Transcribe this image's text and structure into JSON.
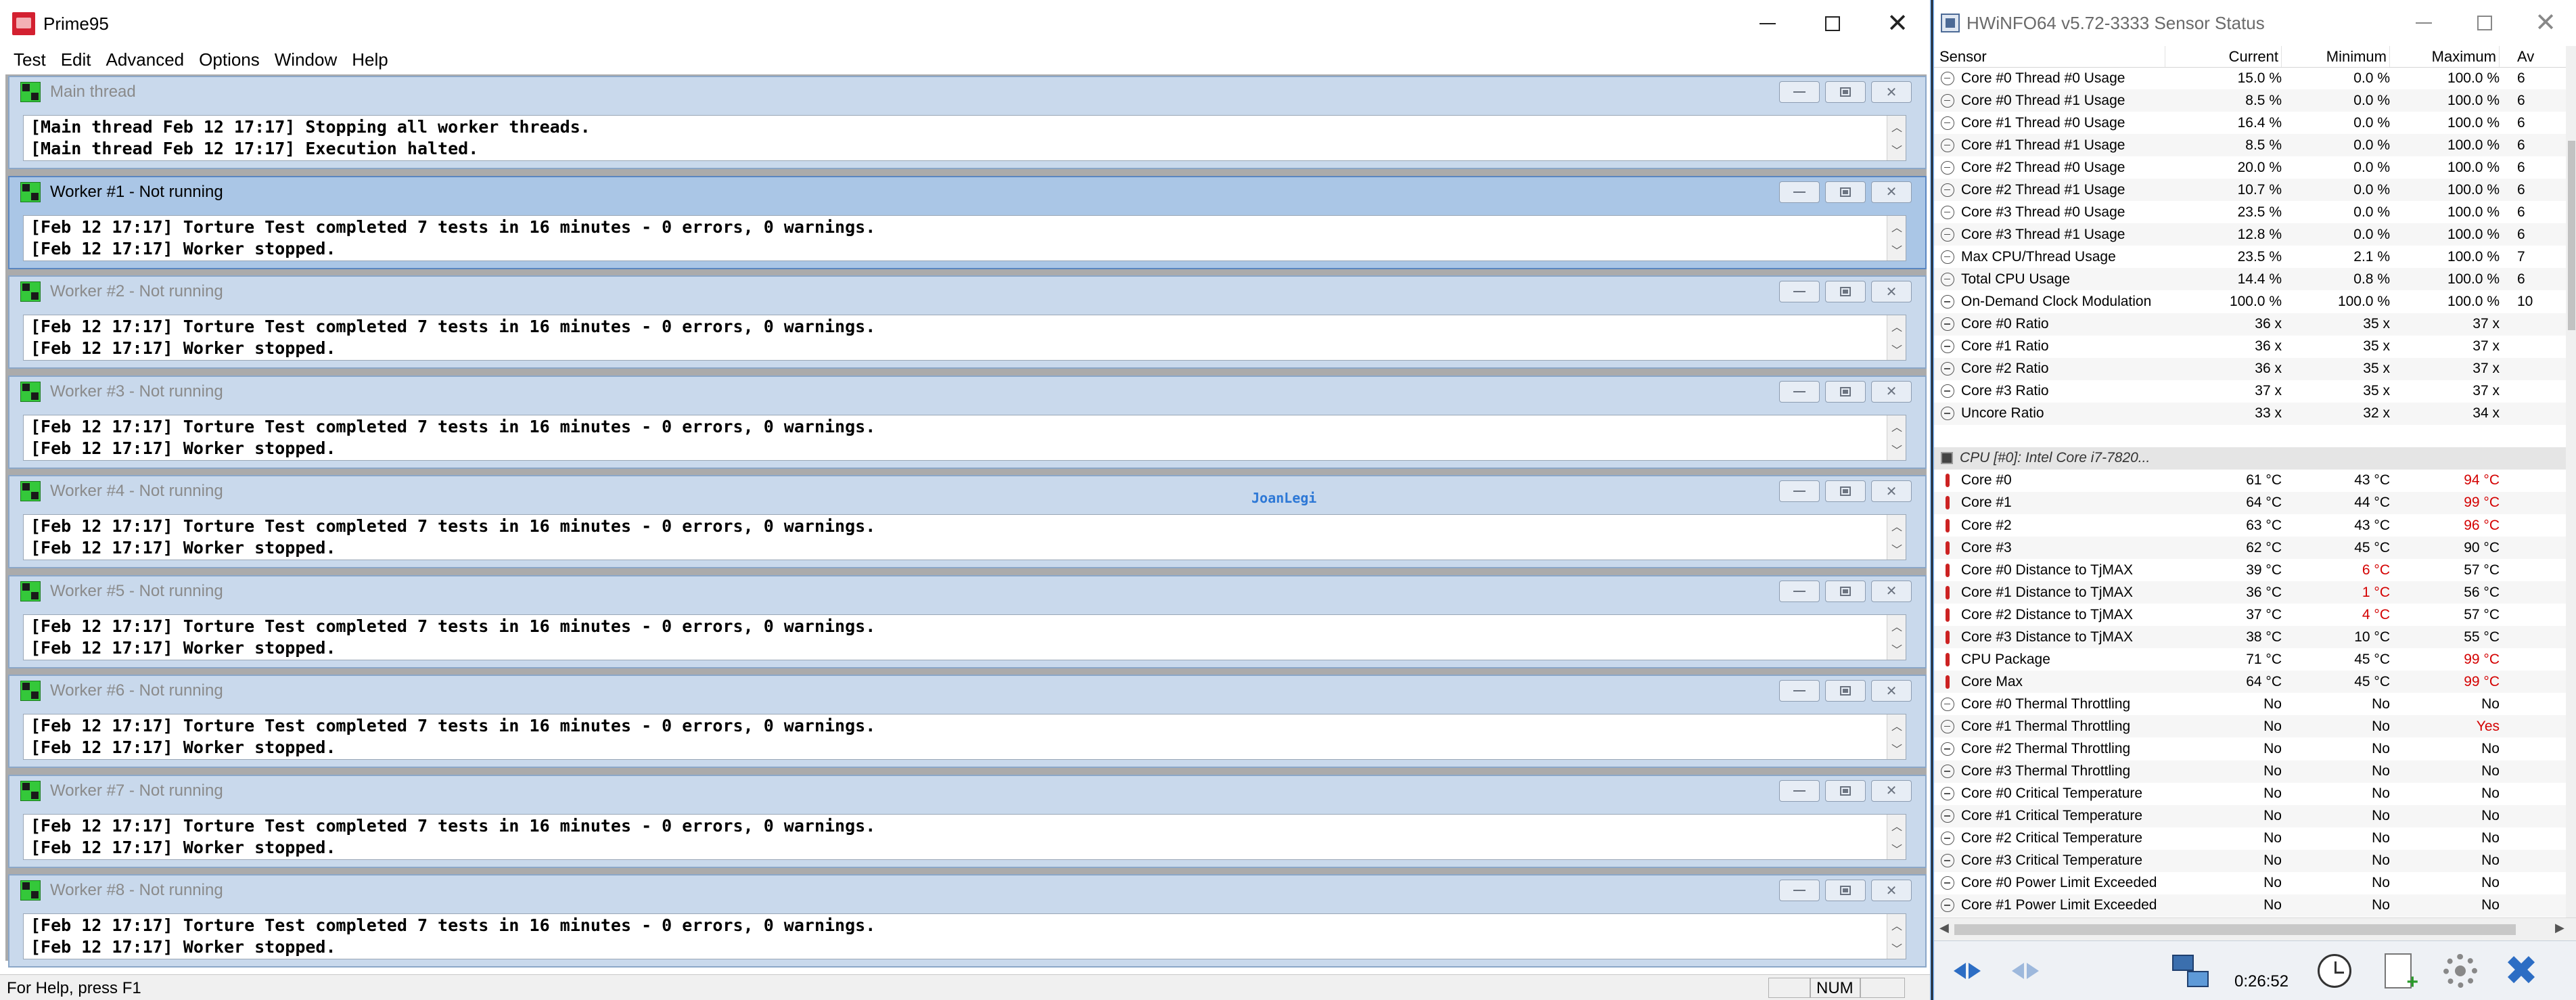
{
  "prime95": {
    "title": "Prime95",
    "menu": [
      "Test",
      "Edit",
      "Advanced",
      "Options",
      "Window",
      "Help"
    ],
    "workers": [
      {
        "name": "Main thread",
        "active": false,
        "lines": [
          "[Main thread Feb 12 17:17] Stopping all worker threads.",
          "[Main thread Feb 12 17:17] Execution halted."
        ]
      },
      {
        "name": "Worker #1 - Not running",
        "active": true,
        "lines": [
          "[Feb 12 17:17] Torture Test completed 7 tests in 16 minutes - 0 errors, 0 warnings.",
          "[Feb 12 17:17] Worker stopped."
        ]
      },
      {
        "name": "Worker #2 - Not running",
        "active": false,
        "lines": [
          "[Feb 12 17:17] Torture Test completed 7 tests in 16 minutes - 0 errors, 0 warnings.",
          "[Feb 12 17:17] Worker stopped."
        ]
      },
      {
        "name": "Worker #3 - Not running",
        "active": false,
        "lines": [
          "[Feb 12 17:17] Torture Test completed 7 tests in 16 minutes - 0 errors, 0 warnings.",
          "[Feb 12 17:17] Worker stopped."
        ]
      },
      {
        "name": "Worker #4 - Not running",
        "active": false,
        "lines": [
          "[Feb 12 17:17] Torture Test completed 7 tests in 16 minutes - 0 errors, 0 warnings.",
          "[Feb 12 17:17] Worker stopped."
        ]
      },
      {
        "name": "Worker #5 - Not running",
        "active": false,
        "lines": [
          "[Feb 12 17:17] Torture Test completed 7 tests in 16 minutes - 0 errors, 0 warnings.",
          "[Feb 12 17:17] Worker stopped."
        ]
      },
      {
        "name": "Worker #6 - Not running",
        "active": false,
        "lines": [
          "[Feb 12 17:17] Torture Test completed 7 tests in 16 minutes - 0 errors, 0 warnings.",
          "[Feb 12 17:17] Worker stopped."
        ]
      },
      {
        "name": "Worker #7 - Not running",
        "active": false,
        "lines": [
          "[Feb 12 17:17] Torture Test completed 7 tests in 16 minutes - 0 errors, 0 warnings.",
          "[Feb 12 17:17] Worker stopped."
        ]
      },
      {
        "name": "Worker #8 - Not running",
        "active": false,
        "lines": [
          "[Feb 12 17:17] Torture Test completed 7 tests in 16 minutes - 0 errors, 0 warnings.",
          "[Feb 12 17:17] Worker stopped."
        ]
      }
    ],
    "watermark": "JoanLegi",
    "status_text": "For Help, press F1",
    "status_num": "NUM"
  },
  "hwinfo": {
    "title": "HWiNFO64 v5.72-3333 Sensor Status",
    "columns": {
      "sensor": "Sensor",
      "current": "Current",
      "minimum": "Minimum",
      "maximum": "Maximum",
      "average": "Av"
    },
    "rows": [
      {
        "icon": "clock",
        "label": "Core #0 Thread #0 Usage",
        "cur": "15.0 %",
        "min": "0.0 %",
        "max": "100.0 %",
        "avg": "6"
      },
      {
        "icon": "clock",
        "label": "Core #0 Thread #1 Usage",
        "cur": "8.5 %",
        "min": "0.0 %",
        "max": "100.0 %",
        "avg": "6"
      },
      {
        "icon": "clock",
        "label": "Core #1 Thread #0 Usage",
        "cur": "16.4 %",
        "min": "0.0 %",
        "max": "100.0 %",
        "avg": "6"
      },
      {
        "icon": "clock",
        "label": "Core #1 Thread #1 Usage",
        "cur": "8.5 %",
        "min": "0.0 %",
        "max": "100.0 %",
        "avg": "6"
      },
      {
        "icon": "clock",
        "label": "Core #2 Thread #0 Usage",
        "cur": "20.0 %",
        "min": "0.0 %",
        "max": "100.0 %",
        "avg": "6"
      },
      {
        "icon": "clock",
        "label": "Core #2 Thread #1 Usage",
        "cur": "10.7 %",
        "min": "0.0 %",
        "max": "100.0 %",
        "avg": "6"
      },
      {
        "icon": "clock",
        "label": "Core #3 Thread #0 Usage",
        "cur": "23.5 %",
        "min": "0.0 %",
        "max": "100.0 %",
        "avg": "6"
      },
      {
        "icon": "clock",
        "label": "Core #3 Thread #1 Usage",
        "cur": "12.8 %",
        "min": "0.0 %",
        "max": "100.0 %",
        "avg": "6"
      },
      {
        "icon": "clock",
        "label": "Max CPU/Thread Usage",
        "cur": "23.5 %",
        "min": "2.1 %",
        "max": "100.0 %",
        "avg": "7"
      },
      {
        "icon": "clock",
        "label": "Total CPU Usage",
        "cur": "14.4 %",
        "min": "0.8 %",
        "max": "100.0 %",
        "avg": "6"
      },
      {
        "icon": "clock",
        "label": "On-Demand Clock Modulation",
        "cur": "100.0 %",
        "min": "100.0 %",
        "max": "100.0 %",
        "avg": "10"
      },
      {
        "icon": "clock",
        "label": "Core #0 Ratio",
        "cur": "36 x",
        "min": "35 x",
        "max": "37 x",
        "avg": ""
      },
      {
        "icon": "clock",
        "label": "Core #1 Ratio",
        "cur": "36 x",
        "min": "35 x",
        "max": "37 x",
        "avg": ""
      },
      {
        "icon": "clock",
        "label": "Core #2 Ratio",
        "cur": "36 x",
        "min": "35 x",
        "max": "37 x",
        "avg": ""
      },
      {
        "icon": "clock",
        "label": "Core #3 Ratio",
        "cur": "37 x",
        "min": "35 x",
        "max": "37 x",
        "avg": ""
      },
      {
        "icon": "clock",
        "label": "Uncore Ratio",
        "cur": "33 x",
        "min": "32 x",
        "max": "34 x",
        "avg": ""
      },
      {
        "icon": "none",
        "label": "",
        "cur": "",
        "min": "",
        "max": "",
        "avg": ""
      },
      {
        "icon": "chip",
        "label": "CPU [#0]: Intel Core i7-7820...",
        "cur": "",
        "min": "",
        "max": "",
        "avg": "",
        "group": true
      },
      {
        "icon": "temp",
        "label": "Core #0",
        "cur": "61 °C",
        "min": "43 °C",
        "max": "94 °C",
        "avg": "",
        "max_red": true
      },
      {
        "icon": "temp",
        "label": "Core #1",
        "cur": "64 °C",
        "min": "44 °C",
        "max": "99 °C",
        "avg": "",
        "max_red": true
      },
      {
        "icon": "temp",
        "label": "Core #2",
        "cur": "63 °C",
        "min": "43 °C",
        "max": "96 °C",
        "avg": "",
        "max_red": true
      },
      {
        "icon": "temp",
        "label": "Core #3",
        "cur": "62 °C",
        "min": "45 °C",
        "max": "90 °C",
        "avg": ""
      },
      {
        "icon": "temp",
        "label": "Core #0 Distance to TjMAX",
        "cur": "39 °C",
        "min": "6 °C",
        "max": "57 °C",
        "avg": "",
        "min_red": true
      },
      {
        "icon": "temp",
        "label": "Core #1 Distance to TjMAX",
        "cur": "36 °C",
        "min": "1 °C",
        "max": "56 °C",
        "avg": "",
        "min_red": true
      },
      {
        "icon": "temp",
        "label": "Core #2 Distance to TjMAX",
        "cur": "37 °C",
        "min": "4 °C",
        "max": "57 °C",
        "avg": "",
        "min_red": true
      },
      {
        "icon": "temp",
        "label": "Core #3 Distance to TjMAX",
        "cur": "38 °C",
        "min": "10 °C",
        "max": "55 °C",
        "avg": ""
      },
      {
        "icon": "temp",
        "label": "CPU Package",
        "cur": "71 °C",
        "min": "45 °C",
        "max": "99 °C",
        "avg": "",
        "max_red": true
      },
      {
        "icon": "temp",
        "label": "Core Max",
        "cur": "64 °C",
        "min": "45 °C",
        "max": "99 °C",
        "avg": "",
        "max_red": true
      },
      {
        "icon": "clock",
        "label": "Core #0 Thermal Throttling",
        "cur": "No",
        "min": "No",
        "max": "No",
        "avg": ""
      },
      {
        "icon": "clock",
        "label": "Core #1 Thermal Throttling",
        "cur": "No",
        "min": "No",
        "max": "Yes",
        "avg": "",
        "max_red": true
      },
      {
        "icon": "clock",
        "label": "Core #2 Thermal Throttling",
        "cur": "No",
        "min": "No",
        "max": "No",
        "avg": ""
      },
      {
        "icon": "clock",
        "label": "Core #3 Thermal Throttling",
        "cur": "No",
        "min": "No",
        "max": "No",
        "avg": ""
      },
      {
        "icon": "clock",
        "label": "Core #0 Critical Temperature",
        "cur": "No",
        "min": "No",
        "max": "No",
        "avg": ""
      },
      {
        "icon": "clock",
        "label": "Core #1 Critical Temperature",
        "cur": "No",
        "min": "No",
        "max": "No",
        "avg": ""
      },
      {
        "icon": "clock",
        "label": "Core #2 Critical Temperature",
        "cur": "No",
        "min": "No",
        "max": "No",
        "avg": ""
      },
      {
        "icon": "clock",
        "label": "Core #3 Critical Temperature",
        "cur": "No",
        "min": "No",
        "max": "No",
        "avg": ""
      },
      {
        "icon": "clock",
        "label": "Core #0 Power Limit Exceeded",
        "cur": "No",
        "min": "No",
        "max": "No",
        "avg": ""
      },
      {
        "icon": "clock",
        "label": "Core #1 Power Limit Exceeded",
        "cur": "No",
        "min": "No",
        "max": "No",
        "avg": ""
      }
    ],
    "elapsed": "0:26:52"
  },
  "colors": {
    "accent": "#2c6dc4",
    "alert": "#d40000",
    "mdi_active": "#aac6e6",
    "mdi_inactive": "#c9d9ec"
  }
}
